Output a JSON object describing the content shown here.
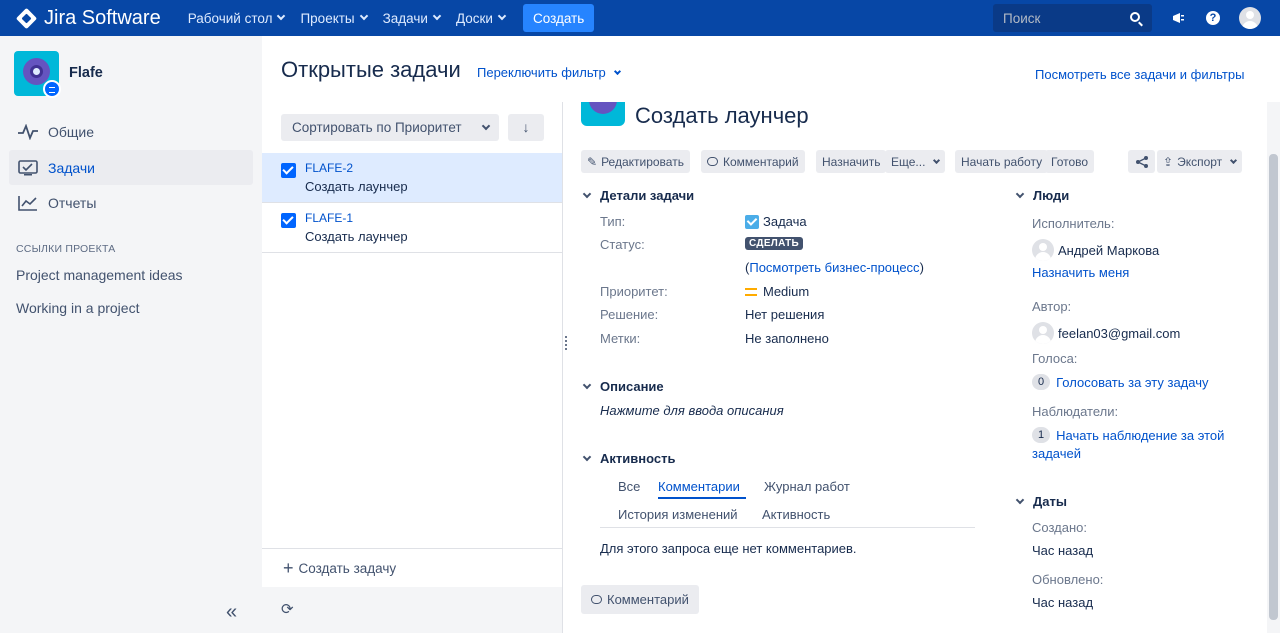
{
  "topbar": {
    "logo": "Jira Software",
    "nav": [
      "Рабочий стол",
      "Проекты",
      "Задачи",
      "Доски"
    ],
    "create": "Создать",
    "search_placeholder": "Поиск"
  },
  "sidebar": {
    "project_name": "Flafe",
    "items": [
      {
        "label": "Общие",
        "icon": "pulse-icon"
      },
      {
        "label": "Задачи",
        "icon": "tasks-icon",
        "active": true
      },
      {
        "label": "Отчеты",
        "icon": "chart-icon"
      }
    ],
    "links_heading": "ССЫЛКИ ПРОЕКТА",
    "links": [
      "Project management ideas",
      "Working in a project"
    ]
  },
  "header": {
    "title": "Открытые задачи",
    "switch_filter": "Переключить фильтр",
    "view_all": "Посмотреть все задачи и фильтры"
  },
  "list": {
    "sort_label": "Сортировать по Приоритет",
    "sort_dir": "↓",
    "issues": [
      {
        "key": "FLAFE-2",
        "summary": "Создать лаунчер",
        "selected": true
      },
      {
        "key": "FLAFE-1",
        "summary": "Создать лаунчер",
        "selected": false
      }
    ],
    "create_issue": "Создать задачу"
  },
  "issue": {
    "title": "Создать лаунчер",
    "toolbar": {
      "edit": "Редактировать",
      "comment": "Комментарий",
      "assign": "Назначить",
      "more": "Еще...",
      "start": "Начать работу",
      "done": "Готово",
      "export": "Экспорт"
    },
    "details": {
      "heading": "Детали задачи",
      "type_label": "Тип:",
      "type_value": "Задача",
      "status_label": "Статус:",
      "status_value": "СДЕЛАТЬ",
      "workflow_open": "(",
      "workflow_link": "Посмотреть бизнес-процесс",
      "workflow_close": ")",
      "priority_label": "Приоритет:",
      "priority_value": "Medium",
      "resolution_label": "Решение:",
      "resolution_value": "Нет решения",
      "labels_label": "Метки:",
      "labels_value": "Не заполнено"
    },
    "description": {
      "heading": "Описание",
      "placeholder": "Нажмите для ввода описания"
    },
    "activity": {
      "heading": "Активность",
      "tabs": [
        "Все",
        "Комментарии",
        "Журнал работ",
        "История изменений",
        "Активность"
      ],
      "active_tab": "Комментарии",
      "empty": "Для этого запроса еще нет комментариев.",
      "comment_button": "Комментарий"
    },
    "people": {
      "heading": "Люди",
      "assignee_label": "Исполнитель:",
      "assignee": "Андрей Маркова",
      "assign_me": "Назначить меня",
      "reporter_label": "Автор:",
      "reporter": "feelan03@gmail.com",
      "votes_label": "Голоса:",
      "votes_count": "0",
      "vote_link": "Голосовать за эту задачу",
      "watchers_label": "Наблюдатели:",
      "watchers_count": "1",
      "watch_link_1": "Начать наблюдение за этой",
      "watch_link_2": "задачей"
    },
    "dates": {
      "heading": "Даты",
      "created_label": "Создано:",
      "created": "Час назад",
      "updated_label": "Обновлено:",
      "updated": "Час назад"
    }
  }
}
